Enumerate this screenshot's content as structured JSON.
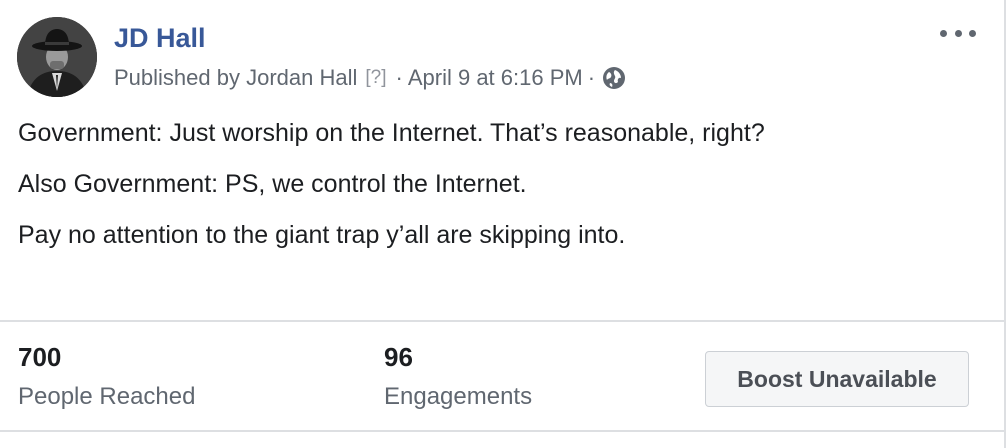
{
  "post": {
    "author": "JD Hall",
    "published_prefix": "Published by",
    "publisher": "Jordan Hall",
    "help_marker": "[?]",
    "separator": "·",
    "date": "April 9 at 6:16 PM",
    "privacy_icon": "globe-icon",
    "more_icon": "more-options-icon",
    "paragraphs": [
      "Government: Just worship on the Internet. That’s reasonable, right?",
      "Also Government: PS, we control the Internet.",
      "Pay no attention to the giant trap y’all are skipping into."
    ]
  },
  "stats": {
    "reached_value": "700",
    "reached_label": "People Reached",
    "engagements_value": "96",
    "engagements_label": "Engagements"
  },
  "boost": {
    "label": "Boost Unavailable"
  },
  "colors": {
    "name_link": "#385898",
    "secondary_text": "#606770",
    "body_text": "#1c1e21",
    "divider": "#dddfe2"
  }
}
